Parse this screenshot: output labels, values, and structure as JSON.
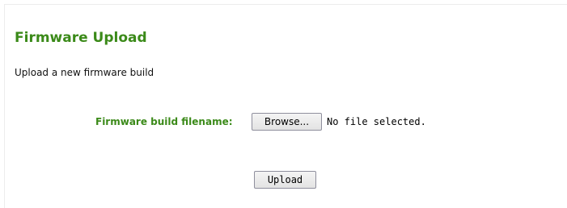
{
  "page": {
    "title": "Firmware Upload",
    "description": "Upload a new firmware build"
  },
  "form": {
    "field_label": "Firmware build filename:",
    "browse_label": "Browse...",
    "file_status": "No file selected.",
    "submit_label": "Upload"
  },
  "colors": {
    "accent": "#3b8a19",
    "text": "#111111",
    "background": "#ffffff"
  }
}
